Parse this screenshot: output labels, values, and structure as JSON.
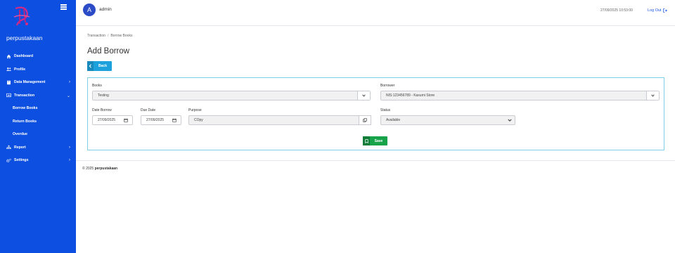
{
  "sidebar": {
    "app_name": "perpustakaan",
    "items": [
      {
        "label": "Dashboard",
        "icon": "home-icon"
      },
      {
        "label": "Profile",
        "icon": "users-icon"
      },
      {
        "label": "Data Management",
        "icon": "book-icon"
      },
      {
        "label": "Transaction",
        "icon": "chart-icon"
      },
      {
        "label": "Borrow Books"
      },
      {
        "label": "Return Books"
      },
      {
        "label": "Overdue"
      },
      {
        "label": "Report",
        "icon": "sitemap-icon"
      },
      {
        "label": "Settings",
        "icon": "cogs-icon"
      }
    ]
  },
  "header": {
    "avatar_letter": "A",
    "username": "admin",
    "datetime": "27/09/2025 10:53:00",
    "logout_label": "Log Out"
  },
  "breadcrumb": {
    "parent": "Transaction",
    "current": "Borrow Books"
  },
  "page": {
    "title": "Add Borrow",
    "back_label": "Back",
    "save_label": "Save"
  },
  "form": {
    "books_label": "Books",
    "books_value": "Testing",
    "borrower_label": "Borrower",
    "borrower_value": "NIS:123456789 - Kaxumi Store",
    "date_borrow_label": "Date Borrow",
    "date_borrow_value": "27/09/2025",
    "due_date_label": "Due Date",
    "due_date_value": "27/09/2025",
    "purpose_label": "Purpose",
    "purpose_value": "COpy",
    "status_label": "Status",
    "status_value": "Available"
  },
  "footer": {
    "copyright": "© 2025",
    "brand": "perpustakaan"
  },
  "colors": {
    "sidebar": "#0d4fe0",
    "back_button": "#1da1dc",
    "save_button": "#16a34a",
    "card_border": "#7fd0e6"
  }
}
